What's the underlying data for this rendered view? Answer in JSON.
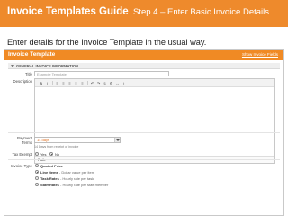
{
  "slide": {
    "title": "Invoice Templates Guide",
    "step": "Step 4 – Enter Basic Invoice Details",
    "instruction": "Enter details for the Invoice Template in the usual way."
  },
  "app": {
    "title": "Invoice Template",
    "link": "Show Invoice Fields",
    "section_title": "GENERAL INVOICE INFORMATION",
    "form": {
      "title_label": "Title",
      "title_value": "Example Template",
      "description_label": "Description",
      "toolbar": [
        "B",
        "I",
        "≡",
        "≡",
        "≡",
        "≡",
        "≡",
        "↶",
        "↷",
        "§",
        "⚙",
        "↔",
        "↕"
      ],
      "path_label": "Path:",
      "payment_terms_label_1": "Payment",
      "payment_terms_label_2": "Terms",
      "payment_terms_value": "14 days",
      "payment_terms_hint": "14 Days from receipt of invoice",
      "tax_exempt_label": "Tax Exempt",
      "tax_yes": "Yes",
      "tax_no": "No",
      "invoice_type_label": "Invoice Type",
      "invoice_types": [
        {
          "name": "Quoted Price",
          "desc": ""
        },
        {
          "name": "Line Items",
          "desc": " - Dollar value per item"
        },
        {
          "name": "Task Rates",
          "desc": " - Hourly rate per task"
        },
        {
          "name": "Staff Rates",
          "desc": " - Hourly rate per staff member"
        }
      ]
    }
  },
  "colors": {
    "accent": "#ee8a2c",
    "app_header": "#f08a24"
  }
}
